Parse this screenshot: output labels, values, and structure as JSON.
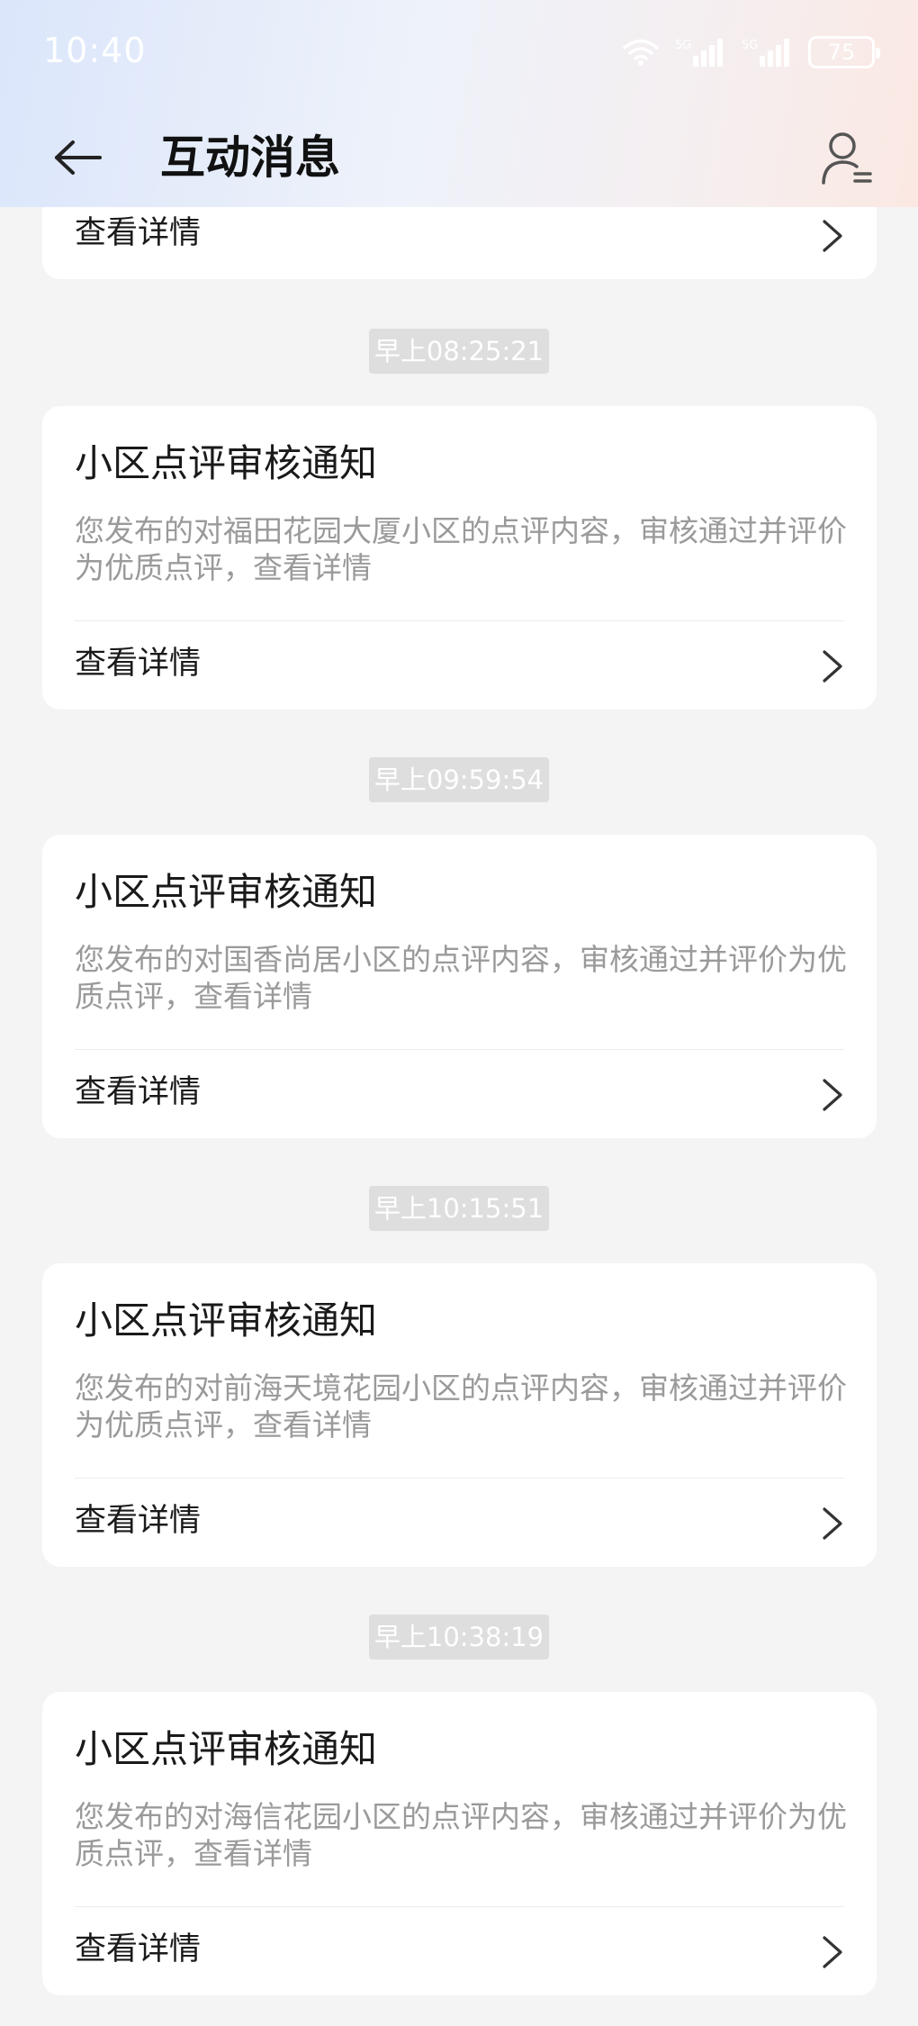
{
  "status_bar": {
    "time": "10:40",
    "battery": "75",
    "signal_1": "5G",
    "signal_2": "5G"
  },
  "nav": {
    "title": "互动消息"
  },
  "partial_card": {
    "detail_label": "查看详情"
  },
  "messages": [
    {
      "timestamp": "早上08:25:21",
      "title": "小区点评审核通知",
      "body": "您发布的对福田花园大厦小区的点评内容，审核通过并评价为优质点评，查看详情",
      "detail_label": "查看详情"
    },
    {
      "timestamp": "早上09:59:54",
      "title": "小区点评审核通知",
      "body": "您发布的对国香尚居小区的点评内容，审核通过并评价为优质点评，查看详情",
      "detail_label": "查看详情"
    },
    {
      "timestamp": "早上10:15:51",
      "title": "小区点评审核通知",
      "body": "您发布的对前海天境花园小区的点评内容，审核通过并评价为优质点评，查看详情",
      "detail_label": "查看详情"
    },
    {
      "timestamp": "早上10:38:19",
      "title": "小区点评审核通知",
      "body": "您发布的对海信花园小区的点评内容，审核通过并评价为优质点评，查看详情",
      "detail_label": "查看详情"
    }
  ],
  "icons": {
    "back": "arrow-left-icon",
    "profile": "user-list-icon",
    "chevron": "chevron-right-icon",
    "wifi": "wifi-icon",
    "signal": "signal-icon",
    "battery": "battery-icon"
  },
  "colors": {
    "background": "#f4f4f4",
    "card": "#ffffff",
    "timestamp_pill": "#dedede",
    "body_text": "#9a9a9a"
  }
}
